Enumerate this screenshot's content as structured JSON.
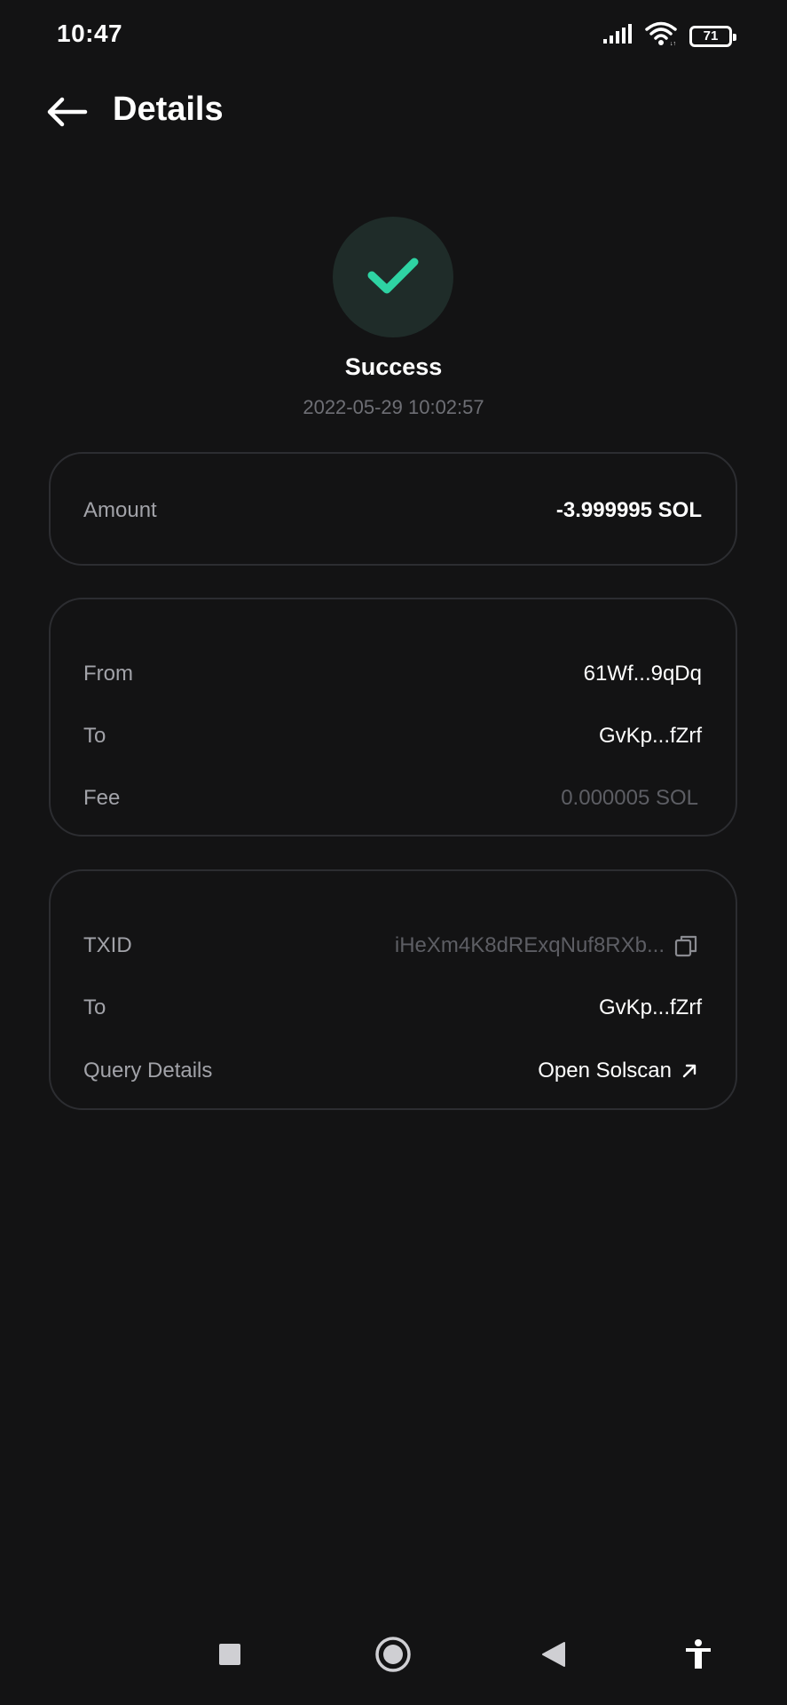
{
  "status_bar": {
    "time": "10:47",
    "battery_level": "71",
    "battery_fraction": 0.71,
    "icons": [
      "signal-icon",
      "wifi-icon",
      "battery-icon"
    ]
  },
  "header": {
    "back_icon": "arrow-left-icon",
    "title": "Details"
  },
  "status": {
    "icon": "check-icon",
    "title": "Success",
    "datetime": "2022-05-29 10:02:57",
    "accent_color": "#2ed3a3"
  },
  "amount_card": {
    "label": "Amount",
    "value": "-3.999995 SOL"
  },
  "transfer_card": {
    "rows": [
      {
        "label": "From",
        "value": "61Wf...9qDq"
      },
      {
        "label": "To",
        "value": "GvKp...fZrf"
      },
      {
        "label": "Fee",
        "value": "0.000005 SOL"
      }
    ]
  },
  "tx_card": {
    "txid_label": "TXID",
    "txid_value": "iHeXm4K8dRExqNuf8RXb...",
    "copy_icon": "copy-icon",
    "to_label": "To",
    "to_value": "GvKp...fZrf",
    "query_label": "Query Details",
    "query_link": "Open Solscan",
    "link_icon": "external-link-icon"
  },
  "nav_bar": {
    "icons": [
      "recents-square-icon",
      "home-circle-icon",
      "back-triangle-icon",
      "accessibility-icon"
    ]
  }
}
